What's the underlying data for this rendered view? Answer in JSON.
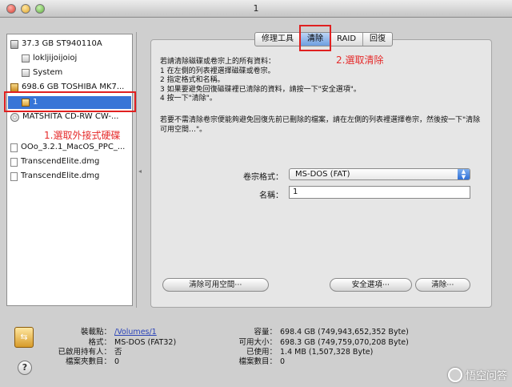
{
  "window": {
    "title": "1"
  },
  "sidebar": {
    "items": [
      {
        "label": "37.3 GB ST940110A",
        "kind": "drive"
      },
      {
        "label": "lokljijoijoioj",
        "kind": "volume"
      },
      {
        "label": "System",
        "kind": "volume"
      },
      {
        "label": "698.6 GB TOSHIBA MK7...",
        "kind": "drive-external"
      },
      {
        "label": "1",
        "kind": "volume-external",
        "selected": true
      },
      {
        "label": "MATSHITA CD-RW CW-...",
        "kind": "optical"
      },
      {
        "label": "OOo_3.2.1_MacOS_PPC_...",
        "kind": "disk-image"
      },
      {
        "label": "TranscendElite.dmg",
        "kind": "disk-image"
      },
      {
        "label": "TranscendElite.dmg",
        "kind": "disk-image"
      }
    ]
  },
  "tabs": [
    {
      "label": "修理工具",
      "selected": false
    },
    {
      "label": "清除",
      "selected": true
    },
    {
      "label": "RAID",
      "selected": false
    },
    {
      "label": "回復",
      "selected": false
    }
  ],
  "erase": {
    "instructions": [
      "若請清除磁碟或卷宗上的所有資料：",
      "1 在左側的列表裡選擇磁碟或卷宗。",
      "2 指定格式和名稱。",
      "3 如果要避免回復磁碟裡已清除的資料，請按一下\"安全選項\"。",
      "4 按一下\"清除\"。"
    ],
    "note": "若要不需清除卷宗便能夠避免回復先前已刪除的檔案，請在左側的列表裡選擇卷宗，然後按一下\"清除可用空間…\"。",
    "format_label": "卷宗格式：",
    "format_value": "MS-DOS (FAT)",
    "name_label": "名稱：",
    "name_value": "1",
    "btn_erase_free": "清除可用空間⋯",
    "btn_security": "安全選項⋯",
    "btn_erase": "清除⋯"
  },
  "info": {
    "mount_label": "裝載點：",
    "mount_value": "/Volumes/1",
    "format_label": "格式：",
    "format_value": "MS-DOS (FAT32)",
    "owners_label": "已啟用持有人：",
    "owners_value": "否",
    "folders_label": "檔案夾數目：",
    "folders_value": "0",
    "capacity_label": "容量：",
    "capacity_value": "698.4 GB (749,943,652,352 Byte)",
    "available_label": "可用大小：",
    "available_value": "698.3 GB (749,759,070,208 Byte)",
    "used_label": "已使用：",
    "used_value": "1.4 MB (1,507,328 Byte)",
    "files_label": "檔案數目：",
    "files_value": "0"
  },
  "annotations": {
    "step1": "1.選取外接式硬碟",
    "step2": "2.選取清除",
    "color": "#e02020"
  },
  "watermark": {
    "text": "悟空问答"
  }
}
